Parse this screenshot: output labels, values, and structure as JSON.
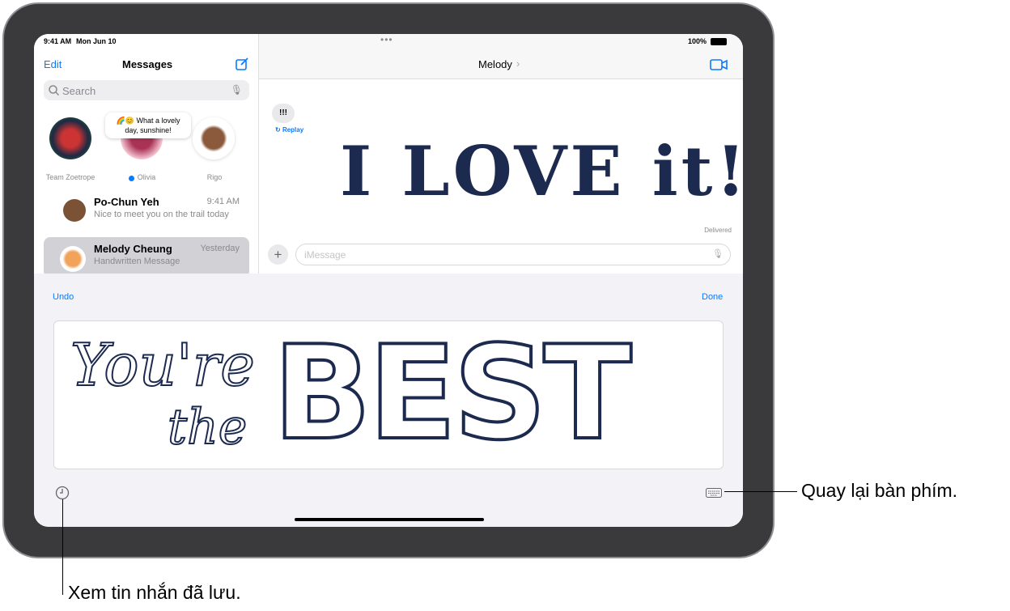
{
  "status": {
    "time": "9:41 AM",
    "date": "Mon Jun 10",
    "battery": "100%"
  },
  "sidebar": {
    "edit": "Edit",
    "title": "Messages",
    "search_placeholder": "Search",
    "pinned": [
      {
        "name": "Team Zoetrope"
      },
      {
        "name": "Olivia",
        "bubble": "🌈😊 What a lovely day, sunshine!",
        "unread": true
      },
      {
        "name": "Rigo"
      }
    ],
    "conversations": [
      {
        "name": "Po-Chun Yeh",
        "time": "9:41 AM",
        "preview": "Nice to meet you on the trail today"
      },
      {
        "name": "Melody Cheung",
        "time": "Yesterday",
        "preview": "Handwritten Message",
        "selected": true
      }
    ]
  },
  "conversation": {
    "contact": "Melody",
    "bubble": "!!!",
    "replay": "Replay",
    "handwriting": "I LOVE it!",
    "status": "Delivered",
    "input_placeholder": "iMessage"
  },
  "handwriting_panel": {
    "undo": "Undo",
    "done": "Done",
    "handwriting_line1": "You're",
    "handwriting_line2": "the",
    "handwriting_big": "BEST"
  },
  "callouts": {
    "keyboard": "Quay lại bàn phím.",
    "saved": "Xem tin nhắn đã lưu."
  },
  "colors": {
    "accent": "#0a7aff",
    "ink": "#1c2a4f"
  }
}
